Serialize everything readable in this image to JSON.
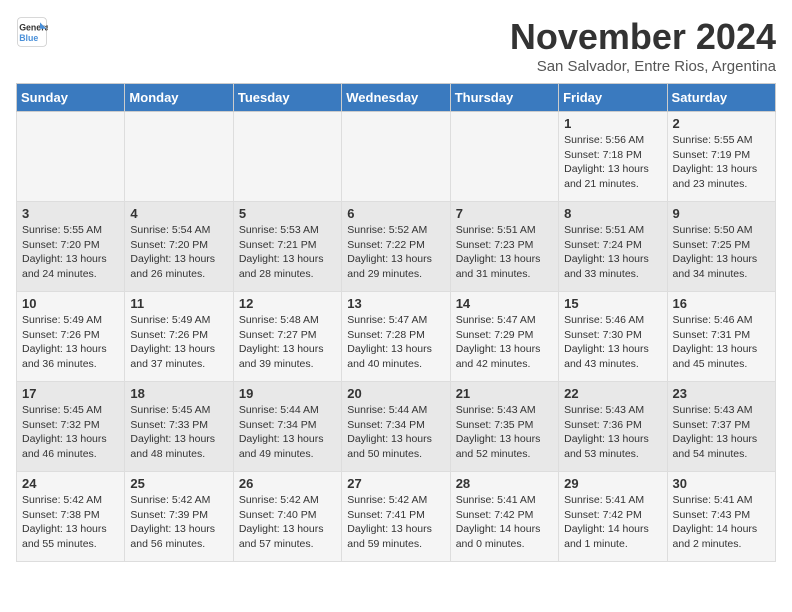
{
  "logo": {
    "line1": "General",
    "line2": "Blue"
  },
  "title": "November 2024",
  "subtitle": "San Salvador, Entre Rios, Argentina",
  "days_header": [
    "Sunday",
    "Monday",
    "Tuesday",
    "Wednesday",
    "Thursday",
    "Friday",
    "Saturday"
  ],
  "weeks": [
    [
      {
        "day": "",
        "info": ""
      },
      {
        "day": "",
        "info": ""
      },
      {
        "day": "",
        "info": ""
      },
      {
        "day": "",
        "info": ""
      },
      {
        "day": "",
        "info": ""
      },
      {
        "day": "1",
        "info": "Sunrise: 5:56 AM\nSunset: 7:18 PM\nDaylight: 13 hours and 21 minutes."
      },
      {
        "day": "2",
        "info": "Sunrise: 5:55 AM\nSunset: 7:19 PM\nDaylight: 13 hours and 23 minutes."
      }
    ],
    [
      {
        "day": "3",
        "info": "Sunrise: 5:55 AM\nSunset: 7:20 PM\nDaylight: 13 hours and 24 minutes."
      },
      {
        "day": "4",
        "info": "Sunrise: 5:54 AM\nSunset: 7:20 PM\nDaylight: 13 hours and 26 minutes."
      },
      {
        "day": "5",
        "info": "Sunrise: 5:53 AM\nSunset: 7:21 PM\nDaylight: 13 hours and 28 minutes."
      },
      {
        "day": "6",
        "info": "Sunrise: 5:52 AM\nSunset: 7:22 PM\nDaylight: 13 hours and 29 minutes."
      },
      {
        "day": "7",
        "info": "Sunrise: 5:51 AM\nSunset: 7:23 PM\nDaylight: 13 hours and 31 minutes."
      },
      {
        "day": "8",
        "info": "Sunrise: 5:51 AM\nSunset: 7:24 PM\nDaylight: 13 hours and 33 minutes."
      },
      {
        "day": "9",
        "info": "Sunrise: 5:50 AM\nSunset: 7:25 PM\nDaylight: 13 hours and 34 minutes."
      }
    ],
    [
      {
        "day": "10",
        "info": "Sunrise: 5:49 AM\nSunset: 7:26 PM\nDaylight: 13 hours and 36 minutes."
      },
      {
        "day": "11",
        "info": "Sunrise: 5:49 AM\nSunset: 7:26 PM\nDaylight: 13 hours and 37 minutes."
      },
      {
        "day": "12",
        "info": "Sunrise: 5:48 AM\nSunset: 7:27 PM\nDaylight: 13 hours and 39 minutes."
      },
      {
        "day": "13",
        "info": "Sunrise: 5:47 AM\nSunset: 7:28 PM\nDaylight: 13 hours and 40 minutes."
      },
      {
        "day": "14",
        "info": "Sunrise: 5:47 AM\nSunset: 7:29 PM\nDaylight: 13 hours and 42 minutes."
      },
      {
        "day": "15",
        "info": "Sunrise: 5:46 AM\nSunset: 7:30 PM\nDaylight: 13 hours and 43 minutes."
      },
      {
        "day": "16",
        "info": "Sunrise: 5:46 AM\nSunset: 7:31 PM\nDaylight: 13 hours and 45 minutes."
      }
    ],
    [
      {
        "day": "17",
        "info": "Sunrise: 5:45 AM\nSunset: 7:32 PM\nDaylight: 13 hours and 46 minutes."
      },
      {
        "day": "18",
        "info": "Sunrise: 5:45 AM\nSunset: 7:33 PM\nDaylight: 13 hours and 48 minutes."
      },
      {
        "day": "19",
        "info": "Sunrise: 5:44 AM\nSunset: 7:34 PM\nDaylight: 13 hours and 49 minutes."
      },
      {
        "day": "20",
        "info": "Sunrise: 5:44 AM\nSunset: 7:34 PM\nDaylight: 13 hours and 50 minutes."
      },
      {
        "day": "21",
        "info": "Sunrise: 5:43 AM\nSunset: 7:35 PM\nDaylight: 13 hours and 52 minutes."
      },
      {
        "day": "22",
        "info": "Sunrise: 5:43 AM\nSunset: 7:36 PM\nDaylight: 13 hours and 53 minutes."
      },
      {
        "day": "23",
        "info": "Sunrise: 5:43 AM\nSunset: 7:37 PM\nDaylight: 13 hours and 54 minutes."
      }
    ],
    [
      {
        "day": "24",
        "info": "Sunrise: 5:42 AM\nSunset: 7:38 PM\nDaylight: 13 hours and 55 minutes."
      },
      {
        "day": "25",
        "info": "Sunrise: 5:42 AM\nSunset: 7:39 PM\nDaylight: 13 hours and 56 minutes."
      },
      {
        "day": "26",
        "info": "Sunrise: 5:42 AM\nSunset: 7:40 PM\nDaylight: 13 hours and 57 minutes."
      },
      {
        "day": "27",
        "info": "Sunrise: 5:42 AM\nSunset: 7:41 PM\nDaylight: 13 hours and 59 minutes."
      },
      {
        "day": "28",
        "info": "Sunrise: 5:41 AM\nSunset: 7:42 PM\nDaylight: 14 hours and 0 minutes."
      },
      {
        "day": "29",
        "info": "Sunrise: 5:41 AM\nSunset: 7:42 PM\nDaylight: 14 hours and 1 minute."
      },
      {
        "day": "30",
        "info": "Sunrise: 5:41 AM\nSunset: 7:43 PM\nDaylight: 14 hours and 2 minutes."
      }
    ]
  ]
}
